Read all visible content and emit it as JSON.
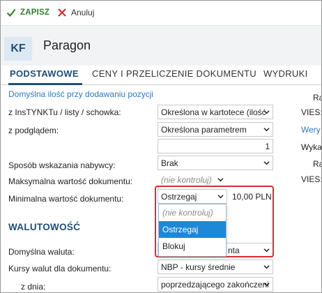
{
  "toolbar": {
    "save_label": "ZAPISZ",
    "cancel_label": "Anuluj"
  },
  "header": {
    "avatar": "KF",
    "title": "Paragon"
  },
  "tabs": [
    {
      "label": "PODSTAWOWE"
    },
    {
      "label": "CENY I PRZELICZENIE DOKUMENTU"
    },
    {
      "label": "WYDRUKI"
    }
  ],
  "form": {
    "link_label": "Domyślna ilość przy dodawaniu pozycji",
    "rows": [
      {
        "label": "z InsTYNKTu / listy / schowka:",
        "value": "Określona w kartotece (ilość"
      },
      {
        "label": "z podglądem:",
        "value": "Określona parametrem"
      },
      {
        "value": "1"
      },
      {
        "label": "Sposób wskazania nabywcy:",
        "value": "Brak"
      },
      {
        "label": "Maksymalna wartość dokumentu:",
        "value": "(nie kontroluj)"
      },
      {
        "label": "Minimalna wartość dokumentu:",
        "value": "Ostrzegaj",
        "amount": "10,00 PLN"
      }
    ],
    "section_waluty": "WALUTOWOŚĆ",
    "currency_rows": [
      {
        "label": "Domyślna waluta:",
        "value": "nta"
      },
      {
        "label": "Kursy walut dla dokumentu:",
        "value": "NBP - kursy średnie"
      },
      {
        "label": "z dnia:",
        "value": "poprzedzającego zakończeni"
      }
    ]
  },
  "right_column": {
    "r1": "Ra",
    "r2": "VIES:",
    "r3": "Wery",
    "r4": "Wyka",
    "r5": "Ra",
    "r6": "VIES:"
  },
  "dropdown": {
    "options": [
      "(nie kontroluj)",
      "Ostrzegaj",
      "Blokuj"
    ],
    "selected": "Ostrzegaj"
  },
  "colors": {
    "accent": "#1f4e79",
    "link": "#2a7ac0",
    "selected": "#1e88d6",
    "highlight": "#e02a2a",
    "save": "#2f7d2f"
  }
}
